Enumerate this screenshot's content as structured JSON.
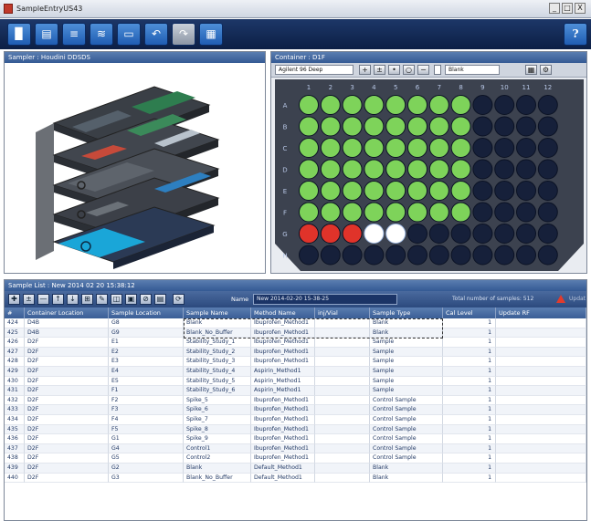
{
  "window": {
    "title": "SampleEntryUS43",
    "buttons": [
      "_",
      "□",
      "X"
    ]
  },
  "toolbar": {
    "buttons": [
      {
        "icon": "new-file-icon",
        "glyph": "▉"
      },
      {
        "icon": "open-folder-icon",
        "glyph": "▤"
      },
      {
        "icon": "save-icon",
        "glyph": "≡"
      },
      {
        "icon": "save-as-icon",
        "glyph": "≋"
      },
      {
        "icon": "print-icon",
        "glyph": "▭"
      },
      {
        "icon": "undo-icon",
        "glyph": "↶"
      },
      {
        "icon": "redo-icon",
        "glyph": "↷"
      },
      {
        "icon": "sample-sheet-icon",
        "glyph": "▦"
      }
    ],
    "help": "?"
  },
  "sampler": {
    "header": "Sampler : Houdini DDSDS"
  },
  "container": {
    "header": "Container : D1F",
    "plate_type": "Agilent 96 Deep",
    "fill_select": "Blank",
    "columns": [
      "1",
      "2",
      "3",
      "4",
      "5",
      "6",
      "7",
      "8",
      "9",
      "10",
      "11",
      "12"
    ],
    "rows": [
      "A",
      "B",
      "C",
      "D",
      "E",
      "F",
      "G",
      "H"
    ],
    "well_colors": {
      "filled": "#7ed35a",
      "red": "#e0332a",
      "white": "#ffffff",
      "empty": "#16203a"
    },
    "row_states": {
      "A": "gggggggg....",
      "B": "gggggggg....",
      "C": "gggggggg....",
      "D": "gggggggg....",
      "E": "gggggggg....",
      "F": "gggggggg....",
      "G": "rrrww.......",
      "H": "............"
    }
  },
  "sample_list": {
    "header": "Sample List : New 2014 02 20 15:38:12",
    "name_label": "Name",
    "name_value": "New 2014-02-20 15-38-25",
    "total_label": "Total number of samples: 512",
    "extra_label": "Updat",
    "toolbar_glyphs": [
      "✚",
      "±",
      "—",
      "↑",
      "↓",
      "⊞",
      "✎",
      "◫",
      "▣",
      "⊘",
      "▤",
      "⟳"
    ],
    "columns": [
      "#",
      "Container Location",
      "Sample Location",
      "Sample Name",
      "Method Name",
      "inj/Vial",
      "Sample Type",
      "Cal Level",
      "Update RF"
    ],
    "rows": [
      [
        "424",
        "D4B",
        "G8",
        "Blank",
        "Ibuprofen_Method1",
        "",
        "Blank",
        "1",
        ""
      ],
      [
        "425",
        "D4B",
        "G9",
        "Blank_No_Buffer",
        "Ibuprofen_Method1",
        "",
        "Blank",
        "1",
        ""
      ],
      [
        "426",
        "D2F",
        "E1",
        "Stability_Study_1",
        "Ibuprofen_Method1",
        "",
        "Sample",
        "1",
        ""
      ],
      [
        "427",
        "D2F",
        "E2",
        "Stability_Study_2",
        "Ibuprofen_Method1",
        "",
        "Sample",
        "1",
        ""
      ],
      [
        "428",
        "D2F",
        "E3",
        "Stability_Study_3",
        "Ibuprofen_Method1",
        "",
        "Sample",
        "1",
        ""
      ],
      [
        "429",
        "D2F",
        "E4",
        "Stability_Study_4",
        "Aspirin_Method1",
        "",
        "Sample",
        "1",
        ""
      ],
      [
        "430",
        "D2F",
        "E5",
        "Stability_Study_5",
        "Aspirin_Method1",
        "",
        "Sample",
        "1",
        ""
      ],
      [
        "431",
        "D2F",
        "F1",
        "Stability_Study_6",
        "Aspirin_Method1",
        "",
        "Sample",
        "1",
        ""
      ],
      [
        "432",
        "D2F",
        "F2",
        "Spike_5",
        "Ibuprofen_Method1",
        "",
        "Control Sample",
        "1",
        ""
      ],
      [
        "433",
        "D2F",
        "F3",
        "Spike_6",
        "Ibuprofen_Method1",
        "",
        "Control Sample",
        "1",
        ""
      ],
      [
        "434",
        "D2F",
        "F4",
        "Spike_7",
        "Ibuprofen_Method1",
        "",
        "Control Sample",
        "1",
        ""
      ],
      [
        "435",
        "D2F",
        "F5",
        "Spike_8",
        "Ibuprofen_Method1",
        "",
        "Control Sample",
        "1",
        ""
      ],
      [
        "436",
        "D2F",
        "G1",
        "Spike_9",
        "Ibuprofen_Method1",
        "",
        "Control Sample",
        "1",
        ""
      ],
      [
        "437",
        "D2F",
        "G4",
        "Control1",
        "Ibuprofen_Method1",
        "",
        "Control Sample",
        "1",
        ""
      ],
      [
        "438",
        "D2F",
        "G5",
        "Control2",
        "Ibuprofen_Method1",
        "",
        "Control Sample",
        "1",
        ""
      ],
      [
        "439",
        "D2F",
        "G2",
        "Blank",
        "Default_Method1",
        "",
        "Blank",
        "1",
        ""
      ],
      [
        "440",
        "D2F",
        "G3",
        "Blank_No_Buffer",
        "Default_Method1",
        "",
        "Blank",
        "1",
        ""
      ]
    ]
  }
}
